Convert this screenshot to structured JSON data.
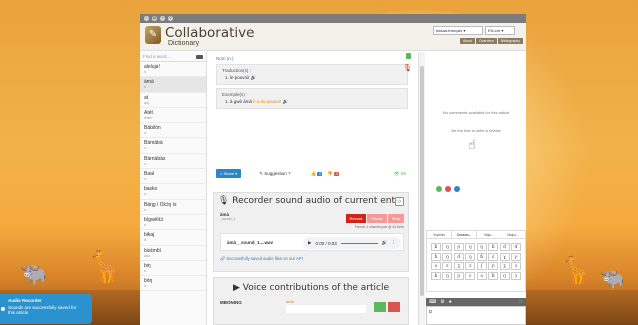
{
  "topbar": {
    "user": "ME",
    "dots": [
      "#5cb85c",
      "#d9534f",
      "#2b86c5"
    ]
  },
  "brand": {
    "line1": "Collaborative",
    "line2": "Dictionary"
  },
  "header": {
    "lang_pair": "basaa-français",
    "lang_code": "EN-cm",
    "links": [
      "About",
      "Overview",
      "Bibliography"
    ]
  },
  "sidebar": {
    "search_placeholder": "Find a word...",
    "words": [
      {
        "w": "aleluja!",
        "g": "n."
      },
      {
        "w": "àmà",
        "g": "n."
      },
      {
        "w": "at",
        "g": "adj."
      },
      {
        "w": "Atèt",
        "g": "letter"
      },
      {
        "w": "Bàbilòn",
        "g": "n."
      },
      {
        "w": "Bàmàbà",
        "g": "n."
      },
      {
        "w": "Bàrnàbàs",
        "g": "n."
      },
      {
        "w": "Baal",
        "g": "n."
      },
      {
        "w": "basko",
        "g": "n."
      },
      {
        "w": "Bàŋg ì Ŋkɔ̀ŋ ìs",
        "g": "n."
      },
      {
        "w": "bígwèlɛ̀ɔ̀",
        "g": "n."
      },
      {
        "w": "bikaj",
        "g": "n."
      },
      {
        "w": "bisɛ̀mɓì",
        "g": "adv."
      },
      {
        "w": "biŋ",
        "g": "n."
      },
      {
        "w": "bóŋ",
        "g": "n."
      }
    ]
  },
  "article": {
    "pos": "Nom (n.)",
    "translation_label": "Traduction(s) :",
    "translation": "1. le pouvoir",
    "example_label": "Exemple(s) :",
    "example_prefix": "1. à gwè àmà ",
    "example_highlight": "il a du pouvoir"
  },
  "actions": {
    "share": "Share",
    "suggestion": "Suggestion ?",
    "likes": "0",
    "dislikes": "0",
    "views": "90"
  },
  "recorder": {
    "title": "Recorder sound audio of current entry",
    "word": "àmà",
    "file": "_sound_1",
    "btn_record": "Record",
    "btn_pause": "Pause",
    "btn_stop": "Stop",
    "format": "Format: 1 channel pcm @ 44.1kHz",
    "player_file": "àmà__sound_1....wav",
    "time": "0:00 / 0:03",
    "saved": "Successfully saved audio files on our API"
  },
  "voice": {
    "title": "Voice contributions of the article",
    "user": "MBONING",
    "word": "àmà"
  },
  "comments": {
    "none": "No comments available for this article",
    "first": "Be the first to write a review"
  },
  "keyboard": {
    "tabs": [
      "Voyelles",
      "Conson...",
      "Maju...",
      "Majus..."
    ],
    "keys": [
      "ɓ",
      "ŋ",
      "ɲ",
      "ŋ",
      "ŋ",
      "ɓ",
      "ɗ",
      "ɗ",
      "ɓ",
      "ŋ",
      "ɗ",
      "ŋ",
      "ɓ",
      "ɛ",
      "ɣ",
      "ƴ",
      "ʌ",
      "ɛ",
      "ʒ",
      "ɔ",
      "ʃ",
      "ɲ",
      "ʒ",
      "ɔ",
      "ɓ",
      "ŋ",
      "ɲ",
      "c",
      "ʌ",
      "ɓ",
      "ŋ",
      "ɔ"
    ]
  },
  "chat": {
    "input": "D"
  },
  "toast": {
    "title": "Audio Recorder",
    "message": "Sounds are successfully saved for this article"
  }
}
